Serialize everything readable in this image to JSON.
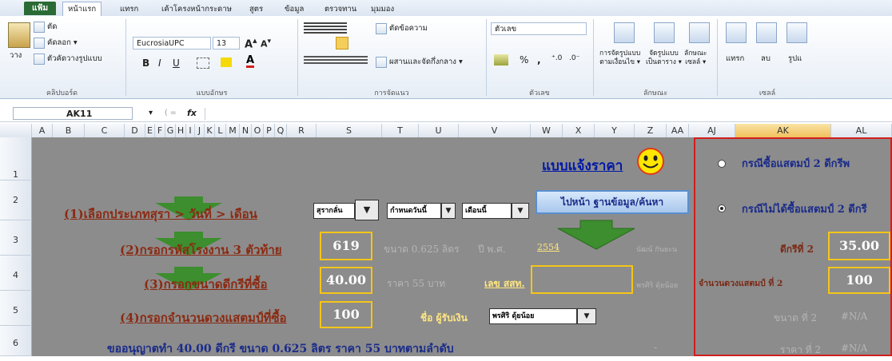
{
  "ribbon_tabs": [
    "แฟ้ม",
    "หน้าแรก",
    "แทรก",
    "เค้าโครงหน้ากระดาษ",
    "สูตร",
    "ข้อมูล",
    "ตรวจทาน",
    "มุมมอง"
  ],
  "clipboard": {
    "paste": "วาง",
    "cut": "ตัด",
    "copy": "คัดลอก ▾",
    "format_painter": "ตัวคัดวางรูปแบบ",
    "group": "คลิปบอร์ด"
  },
  "font": {
    "name": "EucrosiaUPC",
    "size": "13",
    "bold": "B",
    "italic": "I",
    "underline": "U",
    "group": "แบบอักษร"
  },
  "alignment": {
    "wrap": "ตัดข้อความ",
    "merge": "ผสานและจัดกึ่งกลาง ▾",
    "group": "การจัดแนว"
  },
  "number": {
    "format": "ตัวเลข",
    "percent": "%",
    "comma": ",",
    "group": "ตัวเลข"
  },
  "styles": {
    "conditional": "การจัดรูปแบบ",
    "conditional2": "ตามเงื่อนไข ▾",
    "as_table": "จัดรูปแบบ",
    "as_table2": "เป็นตาราง ▾",
    "cell_styles": "ลักษณะ",
    "cell_styles2": "เซลล์ ▾",
    "group": "ลักษณะ"
  },
  "cells": {
    "insert": "แทรก",
    "delete": "ลบ",
    "format": "รูปแ",
    "group": "เซลล์"
  },
  "name_box": "AK11",
  "fx": "fx",
  "columns": [
    "A",
    "B",
    "C",
    "D",
    "E",
    "F",
    "G",
    "H",
    "I",
    "J",
    "K",
    "L",
    "M",
    "N",
    "O",
    "P",
    "Q",
    "R",
    "S",
    "T",
    "U",
    "V",
    "W",
    "X",
    "Y",
    "Z",
    "AA",
    "AJ",
    "AK",
    "AL"
  ],
  "rows": [
    "1",
    "2",
    "3",
    "4",
    "5",
    "6"
  ],
  "sheet": {
    "title": "แบบแจ้งราคา",
    "step1": "(1)เลือกประเภทสุรา > วันที่ > เดือน",
    "step2": "(2)กรอกรหัสโรงงาน 3 ตัวท้าย",
    "step3": "(3)กรอกขนาดดีกรีที่ซื้อ",
    "step4": "(4)กรอกจำนวนดวงแสตมป์ที่ซื้อ",
    "dd_type": "สุรากลั่น",
    "dd_date": "กำหนดวันนี้",
    "dd_month": "เดือนนี้",
    "goto_button": "ไปหน้า ฐานข้อมูล/ค้นหา",
    "factory_code": "619",
    "degree": "40.00",
    "stamps": "100",
    "size_text": "ขนาด 0.625 ลิตร",
    "year_label": "ปี พ.ศ.",
    "year_value": "2554",
    "price_text": "ราคา 55 บาท",
    "tax_no_label": "เลข สสท.",
    "name1": "นัฒน์ กันยะน",
    "name2": "พรศิริ ดุ้ยน้อย",
    "payee_label": "ชื่อ ผู้รับเงิน",
    "payee_value": "พรศิริ ดุ้ยน้อย",
    "summary": "ขออนุญาตทำ 40.00 ดีกรี ขนาด 0.625 ลิตร ราคา 55 บาทตามลำดับ",
    "dash": "-"
  },
  "panel": {
    "option1": "กรณีซื้อแสตมป์ 2 ดีกรีพ",
    "option2": "กรณีไม่ได้ซื้อแสตมป์ 2 ดีกรี",
    "selected_option": 2,
    "degree2_label": "ดีกรีที่ 2",
    "degree2_value": "35.00",
    "stamps2_label": "จำนวนดวงแสตมป์ ที่ 2",
    "stamps2_value": "100",
    "size2_label": "ขนาด ที่ 2",
    "size2_value": "#N/A",
    "price2_label": "ราคา ที่ 2",
    "price2_value": "#N/A"
  },
  "colors": {
    "sheet_bg": "#8c8c8c",
    "highlight_box": "#f5c518",
    "panel_border": "#d21e1e",
    "arrow": "#3c8e2e",
    "file_tab": "#2a6a34"
  }
}
